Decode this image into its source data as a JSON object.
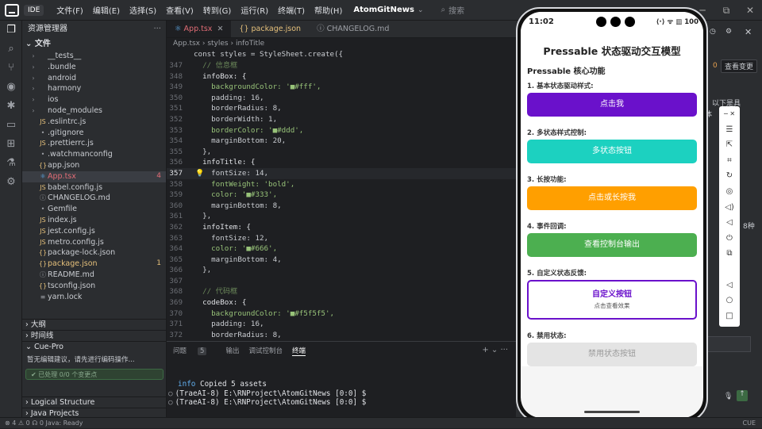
{
  "titlebar": {
    "ide_label": "IDE",
    "menu": [
      "文件(F)",
      "编辑(E)",
      "选择(S)",
      "查看(V)",
      "转到(G)",
      "运行(R)",
      "终端(T)",
      "帮助(H)"
    ],
    "project": "AtomGitNews",
    "search_placeholder": "搜索"
  },
  "explorer": {
    "title": "资源管理器",
    "root": "文件",
    "items": [
      {
        "name": "__tests__",
        "type": "folder"
      },
      {
        "name": ".bundle",
        "type": "folder"
      },
      {
        "name": "android",
        "type": "folder"
      },
      {
        "name": "harmony",
        "type": "folder"
      },
      {
        "name": "ios",
        "type": "folder"
      },
      {
        "name": "node_modules",
        "type": "folder"
      },
      {
        "name": ".eslintrc.js",
        "type": "file"
      },
      {
        "name": ".gitignore",
        "type": "file"
      },
      {
        "name": ".prettierrc.js",
        "type": "file"
      },
      {
        "name": ".watchmanconfig",
        "type": "file"
      },
      {
        "name": "app.json",
        "type": "file"
      },
      {
        "name": "App.tsx",
        "type": "file",
        "badge": "4"
      },
      {
        "name": "babel.config.js",
        "type": "file"
      },
      {
        "name": "CHANGELOG.md",
        "type": "file"
      },
      {
        "name": "Gemfile",
        "type": "file"
      },
      {
        "name": "index.js",
        "type": "file"
      },
      {
        "name": "jest.config.js",
        "type": "file"
      },
      {
        "name": "metro.config.js",
        "type": "file"
      },
      {
        "name": "package-lock.json",
        "type": "file"
      },
      {
        "name": "package.json",
        "type": "file",
        "badge": "1"
      },
      {
        "name": "README.md",
        "type": "file"
      },
      {
        "name": "tsconfig.json",
        "type": "file"
      },
      {
        "name": "yarn.lock",
        "type": "file"
      }
    ],
    "outline": "大纲",
    "timeline": "时间线",
    "cue_title": "Cue-Pro",
    "cue_text": "暂无编辑建议，请先进行编码操作...",
    "cue_bar": "已处理 0/0 个变更点",
    "logical_structure": "Logical Structure",
    "java_projects": "Java Projects"
  },
  "editor": {
    "tabs": [
      "App.tsx",
      "package.json",
      "CHANGELOG.md"
    ],
    "breadcrumb": [
      "App.tsx",
      "styles",
      "infoTitle"
    ],
    "sticky": "const styles = StyleSheet.create({",
    "lines": [
      {
        "n": "347",
        "t": "  // 信息框"
      },
      {
        "n": "348",
        "t": "  infoBox: {"
      },
      {
        "n": "349",
        "t": "    backgroundColor: '■#fff',"
      },
      {
        "n": "350",
        "t": "    padding: 16,"
      },
      {
        "n": "351",
        "t": "    borderRadius: 8,"
      },
      {
        "n": "352",
        "t": "    borderWidth: 1,"
      },
      {
        "n": "353",
        "t": "    borderColor: '■#ddd',"
      },
      {
        "n": "354",
        "t": "    marginBottom: 20,"
      },
      {
        "n": "355",
        "t": "  },"
      },
      {
        "n": "356",
        "t": "  infoTitle: {"
      },
      {
        "n": "357",
        "t": "    fontSize: 14,"
      },
      {
        "n": "358",
        "t": "    fontWeight: 'bold',"
      },
      {
        "n": "359",
        "t": "    color: '■#333',"
      },
      {
        "n": "360",
        "t": "    marginBottom: 8,"
      },
      {
        "n": "361",
        "t": "  },"
      },
      {
        "n": "362",
        "t": "  infoItem: {"
      },
      {
        "n": "363",
        "t": "    fontSize: 12,"
      },
      {
        "n": "364",
        "t": "    color: '■#666',"
      },
      {
        "n": "365",
        "t": "    marginBottom: 4,"
      },
      {
        "n": "366",
        "t": "  },"
      },
      {
        "n": "367",
        "t": ""
      },
      {
        "n": "368",
        "t": "  // 代码框"
      },
      {
        "n": "369",
        "t": "  codeBox: {"
      },
      {
        "n": "370",
        "t": "    backgroundColor: '■#f5f5f5',"
      },
      {
        "n": "371",
        "t": "    padding: 16,"
      },
      {
        "n": "372",
        "t": "    borderRadius: 8,"
      }
    ]
  },
  "panel": {
    "tabs": [
      "问题",
      "输出",
      "调试控制台",
      "终端"
    ],
    "problem_count": "5",
    "terminal": [
      {
        "prefix": "info",
        "text": " Copied 5 assets"
      },
      {
        "prefix": "",
        "text": "(TraeAI-8) E:\\RNProject\\AtomGitNews [0:0] $"
      },
      {
        "prefix": "",
        "text": "(TraeAI-8) E:\\RNProject\\AtomGitNews [0:0] $"
      }
    ]
  },
  "status": {
    "left": "⊗ 4 ⚠ 0   ☊ 0   Java: Ready",
    "right": "CUE"
  },
  "rightpane": {
    "btn_label": "查看变更",
    "frag1": "0",
    "frag2": "。以下是具",
    "frag3": "体",
    "frag4": "8种"
  },
  "phone": {
    "time": "11:02",
    "status_icons": "⟨·⟩ ᯤ ▥ 100",
    "title": "Pressable 状态驱动交互模型",
    "subtitle": "Pressable 核心功能",
    "sections": [
      {
        "label": "1. 基本状态驱动样式:",
        "button": "点击我",
        "color": "#6a11cb"
      },
      {
        "label": "2. 多状态样式控制:",
        "button": "多状态按钮",
        "color": "#1cd1c0"
      },
      {
        "label": "3. 长按功能:",
        "button": "点击或长按我",
        "color": "#ff9f00"
      },
      {
        "label": "4. 事件回调:",
        "button": "查看控制台输出",
        "color": "#4caf50"
      },
      {
        "label": "5. 自定义状态反馈:",
        "button": "自定义按钮",
        "sub": "点击查看效果",
        "color": "#6a11cb"
      },
      {
        "label": "6. 禁用状态:",
        "button": "禁用状态按钮",
        "color": "#e4e4e4"
      }
    ]
  }
}
